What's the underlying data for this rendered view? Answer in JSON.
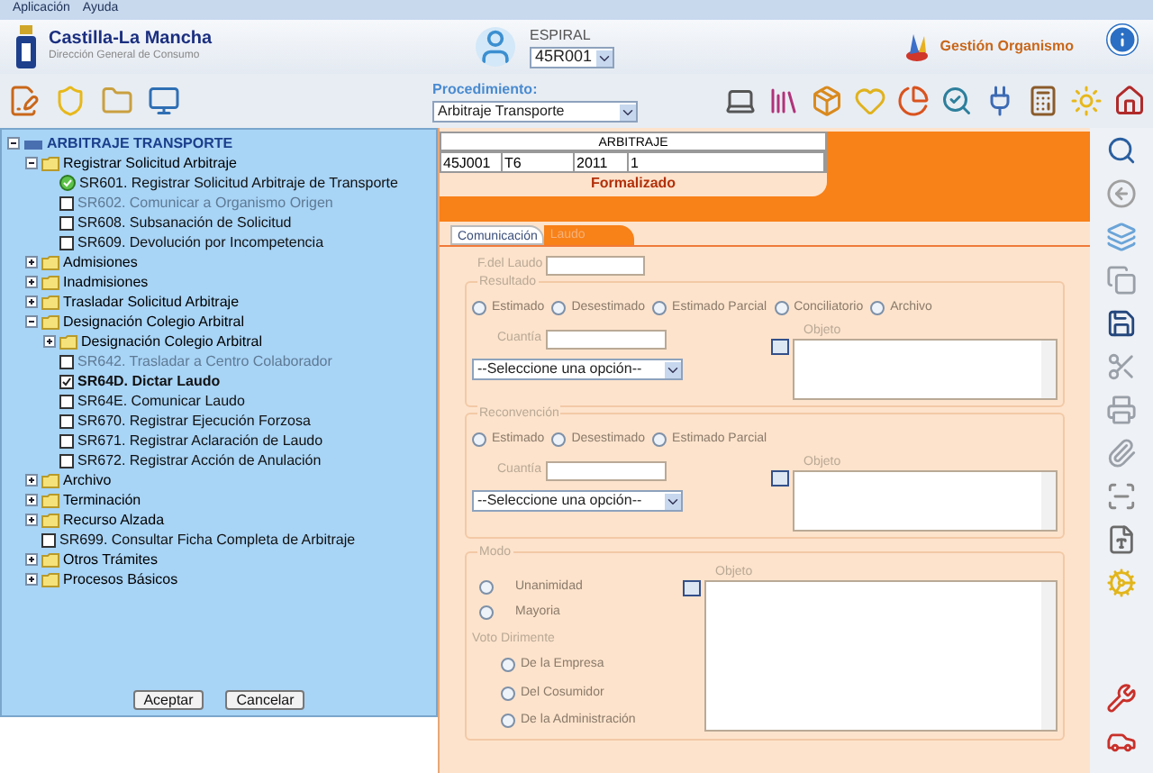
{
  "menu": [
    "Aplicación",
    "Ayuda"
  ],
  "brand": {
    "name": "Castilla-La Mancha",
    "subtitle": "Dirección General de Consumo"
  },
  "user": {
    "label": "ESPIRAL",
    "value": "45R001"
  },
  "organism": "Gestión Organismo",
  "procedure": {
    "label": "Procedimiento:",
    "value": "Arbitraje Transporte"
  },
  "tree": {
    "label": "ARBITRAJE TRANSPORTE",
    "expanded": true,
    "children": [
      {
        "kind": "folder",
        "label": "Registrar Solicitud Arbitraje",
        "expanded": true,
        "children": [
          {
            "kind": "completed",
            "label": "SR601. Registrar Solicitud Arbitraje de Transporte",
            "disabled": false,
            "selected": false
          },
          {
            "kind": "task",
            "label": "SR602. Comunicar a Organismo Origen",
            "checked": false,
            "disabled": true,
            "selected": false
          },
          {
            "kind": "task",
            "label": "SR608. Subsanación de Solicitud",
            "checked": false,
            "disabled": false,
            "selected": false
          },
          {
            "kind": "task",
            "label": "SR609. Devolución por Incompetencia",
            "checked": false,
            "disabled": false,
            "selected": false
          }
        ]
      },
      {
        "kind": "folder",
        "label": "Admisiones",
        "expanded": false
      },
      {
        "kind": "folder",
        "label": "Inadmisiones",
        "expanded": false
      },
      {
        "kind": "folder",
        "label": "Trasladar Solicitud Arbitraje",
        "expanded": false
      },
      {
        "kind": "folder",
        "label": "Designación Colegio Arbitral",
        "expanded": true,
        "children": [
          {
            "kind": "folder",
            "label": "Designación Colegio Arbitral",
            "expanded": false
          },
          {
            "kind": "task",
            "label": "SR642. Trasladar a Centro Colaborador",
            "checked": false,
            "disabled": true,
            "selected": false
          },
          {
            "kind": "task",
            "label": "SR64D. Dictar Laudo",
            "checked": true,
            "disabled": false,
            "selected": true
          },
          {
            "kind": "task",
            "label": "SR64E. Comunicar Laudo",
            "checked": false,
            "disabled": false,
            "selected": false
          },
          {
            "kind": "task",
            "label": "SR670. Registrar Ejecución Forzosa",
            "checked": false,
            "disabled": false,
            "selected": false
          },
          {
            "kind": "task",
            "label": "SR671. Registrar Aclaración de Laudo",
            "checked": false,
            "disabled": false,
            "selected": false
          },
          {
            "kind": "task",
            "label": "SR672. Registrar Acción de Anulación",
            "checked": false,
            "disabled": false,
            "selected": false
          }
        ]
      },
      {
        "kind": "folder",
        "label": "Archivo",
        "expanded": false
      },
      {
        "kind": "folder",
        "label": "Terminación",
        "expanded": false
      },
      {
        "kind": "folder",
        "label": "Recurso Alzada",
        "expanded": false
      },
      {
        "kind": "task",
        "label": "SR699. Consultar Ficha Completa de Arbitraje",
        "checked": false,
        "disabled": false,
        "selected": false
      },
      {
        "kind": "folder",
        "label": "Otros Trámites",
        "expanded": false
      },
      {
        "kind": "folder",
        "label": "Procesos Básicos",
        "expanded": false
      }
    ]
  },
  "tree_buttons": [
    "Aceptar",
    "Cancelar"
  ],
  "record": {
    "title": "ARBITRAJE",
    "cells": [
      "45J001",
      "T6",
      "2011",
      "1"
    ],
    "status": "Formalizado"
  },
  "tabs": [
    {
      "label": "Comunicación",
      "selected": false
    },
    {
      "label": "Laudo",
      "selected": true
    }
  ],
  "form": {
    "date_label": "F.del Laudo",
    "sections": [
      {
        "legend": "Resultado",
        "options": [
          {
            "label": "Estimado",
            "selected": false
          },
          {
            "label": "Desestimado",
            "selected": false
          },
          {
            "label": "Estimado Parcial",
            "selected": false
          },
          {
            "label": "Conciliatorio",
            "selected": false
          },
          {
            "label": "Archivo",
            "selected": false
          }
        ],
        "amount_label": "Cuantía",
        "select": "--Seleccione una opción--",
        "object_label": "Objeto"
      },
      {
        "legend": "Reconvención",
        "options": [
          {
            "label": "Estimado",
            "selected": false
          },
          {
            "label": "Desestimado",
            "selected": false
          },
          {
            "label": "Estimado Parcial",
            "selected": false
          }
        ],
        "amount_label": "Cuantía",
        "select": "--Seleccione una opción--",
        "object_label": "Objeto"
      }
    ],
    "mode": {
      "legend": "Modo",
      "options": [
        {
          "label": "Unanimidad",
          "selected": false
        },
        {
          "label": "Mayoria",
          "selected": false
        }
      ],
      "tiebreak_label": "Voto Dirimente",
      "tiebreak_options": [
        {
          "label": "De la Empresa",
          "selected": false
        },
        {
          "label": "Del Cosumidor",
          "selected": false
        },
        {
          "label": "De la Administración",
          "selected": false
        }
      ],
      "object_label": "Objeto"
    }
  }
}
